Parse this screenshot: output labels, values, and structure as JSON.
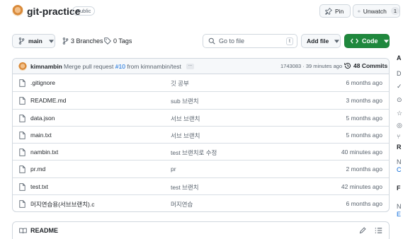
{
  "repo": {
    "name": "git-practice",
    "visibility": "Public"
  },
  "actions": {
    "pin_label": "Pin",
    "watch_label": "Unwatch",
    "watch_count": "1"
  },
  "toolbar": {
    "branch": "main",
    "branches_label": "3 Branches",
    "tags_label": "0 Tags",
    "search_placeholder": "Go to file",
    "search_shortcut": "t",
    "add_file_label": "Add file",
    "code_label": "Code"
  },
  "latest_commit": {
    "author": "kimnambin",
    "message_prefix": "Merge pull request",
    "pr_link": "#10",
    "message_suffix": "from kimnambin/test",
    "ellipsis": "...",
    "hash_time": "1743083 · 39 minutes ago",
    "commits_label": "48 Commits"
  },
  "files": [
    {
      "name": ".gitignore",
      "message": "깃 공부",
      "date": "6 months ago"
    },
    {
      "name": "README.md",
      "message": "sub 브랜치",
      "date": "3 months ago"
    },
    {
      "name": "data.json",
      "message": "서브 브랜치",
      "date": "5 months ago"
    },
    {
      "name": "main.txt",
      "message": "서브 브랜치",
      "date": "5 months ago"
    },
    {
      "name": "nambin.txt",
      "message": "test 브랜치로 수정",
      "date": "40 minutes ago"
    },
    {
      "name": "pr.md",
      "message": "pr",
      "date": "2 months ago"
    },
    {
      "name": "test.txt",
      "message": "test 브랜치",
      "date": "42 minutes ago"
    },
    {
      "name": "머지연습용(서브브랜치).c",
      "message": "머지연습",
      "date": "6 months ago"
    }
  ],
  "readme": {
    "title": "README"
  },
  "sidebar_fragments": [
    "A",
    "D",
    "✓",
    "⊙",
    "☆",
    "◎",
    "⑂",
    "R",
    "N",
    "C",
    "F",
    "N",
    "E"
  ],
  "colors": {
    "accent_green": "#1f883d",
    "link_blue": "#0969da",
    "border": "#d0d7de"
  }
}
